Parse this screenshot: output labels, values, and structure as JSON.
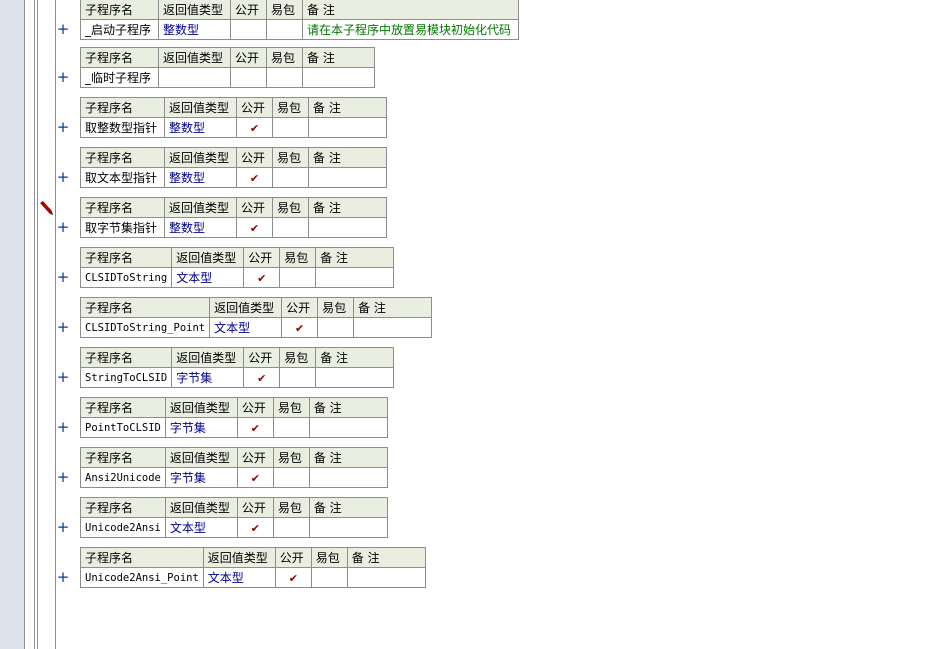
{
  "headers": {
    "name": "子程序名",
    "return_type": "返回值类型",
    "public": "公开",
    "easy_pack": "易包",
    "remark": "备 注"
  },
  "expand_symbol": "+",
  "check_symbol": "✔",
  "procedures": [
    {
      "name": "_启动子程序",
      "return_type": "整数型",
      "public": false,
      "easy_pack": false,
      "remark": "请在本子程序中放置易模块初始化代码"
    },
    {
      "name": "_临时子程序",
      "return_type": "",
      "public": false,
      "easy_pack": false,
      "remark": ""
    },
    {
      "name": "取整数型指针",
      "return_type": "整数型",
      "public": true,
      "easy_pack": false,
      "remark": ""
    },
    {
      "name": "取文本型指针",
      "return_type": "整数型",
      "public": true,
      "easy_pack": false,
      "remark": ""
    },
    {
      "name": "取字节集指针",
      "return_type": "整数型",
      "public": true,
      "easy_pack": false,
      "remark": ""
    },
    {
      "name": "CLSIDToString",
      "return_type": "文本型",
      "public": true,
      "easy_pack": false,
      "remark": ""
    },
    {
      "name": "CLSIDToString_Point",
      "return_type": "文本型",
      "public": true,
      "easy_pack": false,
      "remark": ""
    },
    {
      "name": "StringToCLSID",
      "return_type": "字节集",
      "public": true,
      "easy_pack": false,
      "remark": ""
    },
    {
      "name": "PointToCLSID",
      "return_type": "字节集",
      "public": true,
      "easy_pack": false,
      "remark": ""
    },
    {
      "name": "Ansi2Unicode",
      "return_type": "字节集",
      "public": true,
      "easy_pack": false,
      "remark": ""
    },
    {
      "name": "Unicode2Ansi",
      "return_type": "文本型",
      "public": true,
      "easy_pack": false,
      "remark": ""
    },
    {
      "name": "Unicode2Ansi_Point",
      "return_type": "文本型",
      "public": true,
      "easy_pack": false,
      "remark": ""
    }
  ],
  "colors": {
    "header_bg": "#e9eee1",
    "type_text": "#00008b",
    "remark_text": "#007800",
    "check": "#8b0000",
    "gutter_strip": "#dde3ec"
  },
  "icons": {
    "marker": "pencil-marker-icon"
  }
}
